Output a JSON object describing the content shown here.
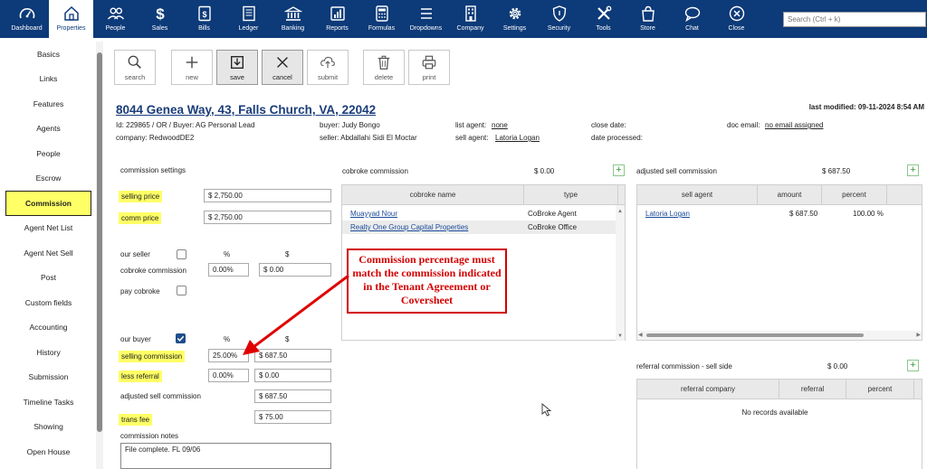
{
  "nav": {
    "items": [
      {
        "label": "Dashboard",
        "icon": "gauge-icon"
      },
      {
        "label": "Properties",
        "icon": "home-icon",
        "active": true
      },
      {
        "label": "People",
        "icon": "people-icon"
      },
      {
        "label": "Sales",
        "icon": "dollar-icon"
      },
      {
        "label": "Bills",
        "icon": "bill-icon"
      },
      {
        "label": "Ledger",
        "icon": "book-icon"
      },
      {
        "label": "Banking",
        "icon": "bank-icon"
      },
      {
        "label": "Reports",
        "icon": "report-icon"
      },
      {
        "label": "Formulas",
        "icon": "calculator-icon"
      },
      {
        "label": "Dropdowns",
        "icon": "menu-icon"
      },
      {
        "label": "Company",
        "icon": "building-icon"
      },
      {
        "label": "Settings",
        "icon": "gear-icon"
      },
      {
        "label": "Security",
        "icon": "shield-icon"
      },
      {
        "label": "Tools",
        "icon": "tools-icon"
      },
      {
        "label": "Store",
        "icon": "bag-icon"
      },
      {
        "label": "Chat",
        "icon": "chat-icon"
      },
      {
        "label": "Close",
        "icon": "close-circle-icon"
      }
    ],
    "search_placeholder": "Search (Ctrl + k)"
  },
  "sidebar": {
    "items": [
      "Basics",
      "Links",
      "Features",
      "Agents",
      "People",
      "Escrow",
      "Commission",
      "Agent Net List",
      "Agent Net Sell",
      "Post",
      "Custom fields",
      "Accounting",
      "History",
      "Submission",
      "Timeline Tasks",
      "Showing",
      "Open House"
    ],
    "active": "Commission"
  },
  "toolbar": {
    "search": "search",
    "new": "new",
    "save": "save",
    "cancel": "cancel",
    "submit": "submit",
    "delete": "delete",
    "print": "print"
  },
  "property": {
    "title": "8044 Genea Way, 43, Falls Church, VA, 22042",
    "last_modified": "last modified: 09-11-2024 8:54 AM",
    "id_line": "Id: 229865 / OR / Buyer: AG Personal Lead",
    "company": "company: RedwoodDE2",
    "buyer": "buyer: Judy Bongo",
    "seller": "seller: Abdallahi Sidi El Moctar",
    "list_agent_label": "list agent:",
    "list_agent": "none",
    "sell_agent_label": "sell agent:",
    "sell_agent": "Latoria Logan",
    "close_date": "close date:",
    "date_processed": "date processed:",
    "doc_email_label": "doc email:",
    "doc_email": "no email assigned"
  },
  "commission": {
    "settings_label": "commission settings",
    "selling_price_label": "selling price",
    "selling_price": "$ 2,750.00",
    "comm_price_label": "comm price",
    "comm_price": "$ 2,750.00",
    "our_seller": "our seller",
    "pct_header": "%",
    "dollar_header": "$",
    "cobroke_commission_label": "cobroke commission",
    "cobroke_pct": "0.00%",
    "cobroke_amt": "$ 0.00",
    "pay_cobroke": "pay cobroke",
    "our_buyer": "our buyer",
    "pct_header2": "%",
    "dollar_header2": "$",
    "selling_commission_label": "selling commission",
    "selling_commission_pct": "25.00%",
    "selling_commission_amt": "$ 687.50",
    "less_referral_label": "less referral",
    "less_referral_pct": "0.00%",
    "less_referral_amt": "$ 0.00",
    "adjusted_label": "adjusted sell commission",
    "adjusted_amt": "$ 687.50",
    "trans_fee_label": "trans fee",
    "trans_fee": "$ 75.00",
    "notes_label": "commission notes",
    "notes": "File complete. FL 09/06"
  },
  "cobroke": {
    "title": "cobroke commission",
    "total": "$ 0.00",
    "headers": [
      "cobroke name",
      "type"
    ],
    "rows": [
      {
        "name": "Muayyad Nour",
        "type": "CoBroke Agent"
      },
      {
        "name": "Realty One Group Capital Properties",
        "type": "CoBroke Office"
      }
    ]
  },
  "adjusted": {
    "title": "adjusted sell commission",
    "total": "$ 687.50",
    "headers": [
      "sell agent",
      "amount",
      "percent"
    ],
    "rows": [
      {
        "agent": "Latoria Logan",
        "amount": "$ 687.50",
        "percent": "100.00 %"
      }
    ]
  },
  "referral": {
    "title": "referral commission - sell side",
    "total": "$ 0.00",
    "headers": [
      "referral company",
      "referral",
      "percent"
    ],
    "empty": "No records available"
  },
  "annotation": {
    "text": "Commission percentage must match the commission indicated in the Tenant Agreement or Coversheet",
    "color": "#d40000"
  }
}
